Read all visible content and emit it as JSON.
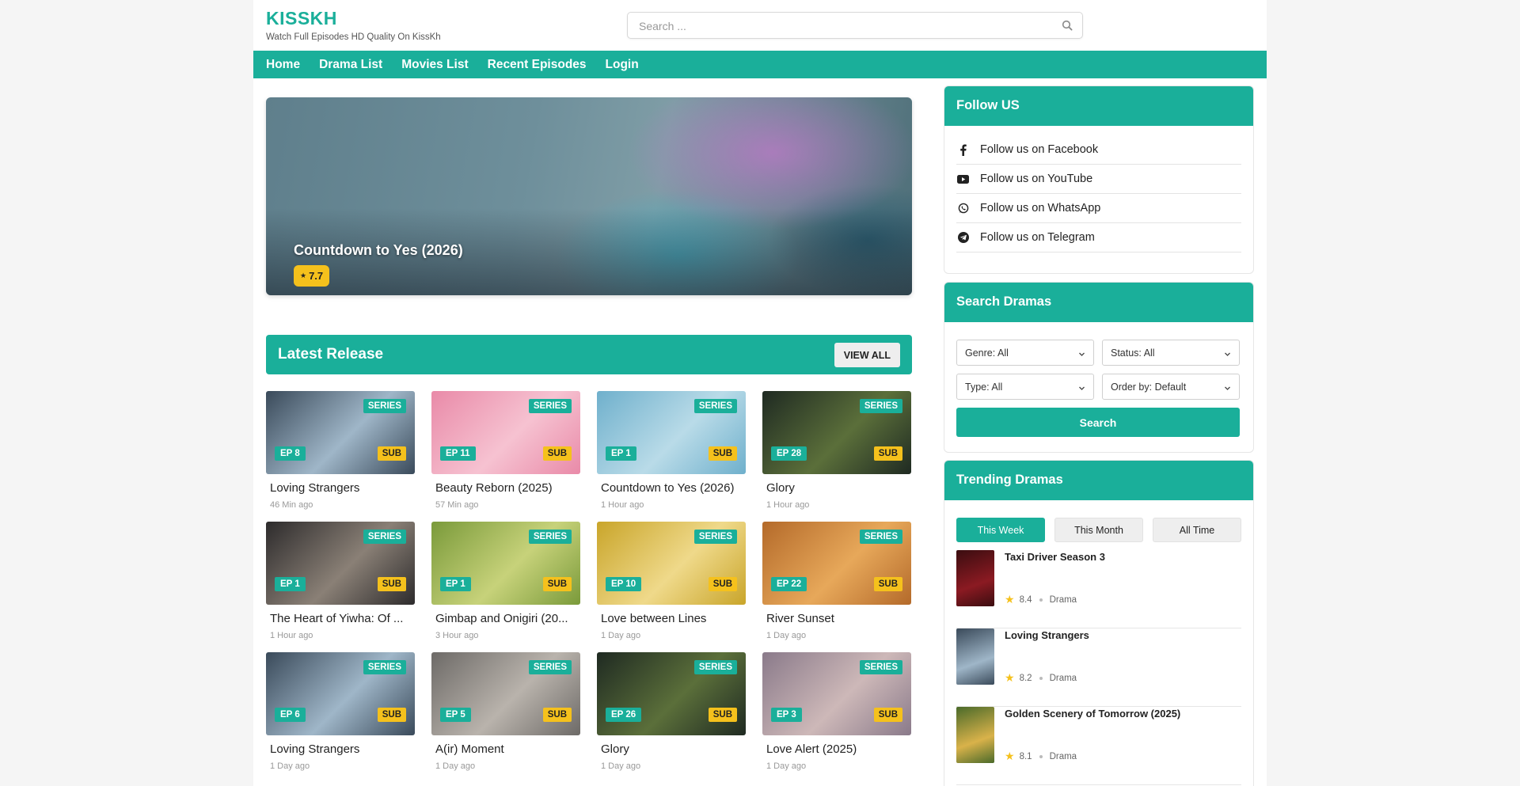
{
  "site": {
    "logo": "KISSKH",
    "tagline": "Watch Full Episodes HD Quality On KissKh",
    "search_placeholder": "Search ..."
  },
  "nav": {
    "items": [
      "Home",
      "Drama List",
      "Movies List",
      "Recent Episodes",
      "Login"
    ]
  },
  "hero": {
    "title": "Countdown to Yes (2026)",
    "rating": "7.7",
    "rating_icon": "star-icon"
  },
  "latest": {
    "title": "Latest Release",
    "view_all": "VIEW ALL",
    "series_label": "SERIES",
    "sub_label": "SUB",
    "items": [
      {
        "title": "Loving Strangers",
        "ep": "EP 8",
        "time": "46 Min ago",
        "colors": [
          "#3a4a5a",
          "#9fb6c8"
        ]
      },
      {
        "title": "Beauty Reborn (2025)",
        "ep": "EP 11",
        "time": "57 Min ago",
        "colors": [
          "#e98aa8",
          "#f6c2d1"
        ]
      },
      {
        "title": "Countdown to Yes (2026)",
        "ep": "EP 1",
        "time": "1 Hour ago",
        "colors": [
          "#6fb0cc",
          "#b9dbe8"
        ]
      },
      {
        "title": "Glory",
        "ep": "EP 28",
        "time": "1 Hour ago",
        "colors": [
          "#1f2a22",
          "#5b6f3a"
        ]
      },
      {
        "title": "The Heart of Yiwha: Of ...",
        "ep": "EP 1",
        "time": "1 Hour ago",
        "colors": [
          "#2d2b2c",
          "#8a8076"
        ]
      },
      {
        "title": "Gimbap and Onigiri (20...",
        "ep": "EP 1",
        "time": "3 Hour ago",
        "colors": [
          "#7a9a3a",
          "#c7d27a"
        ]
      },
      {
        "title": "Love between Lines",
        "ep": "EP 10",
        "time": "1 Day ago",
        "colors": [
          "#c9a52a",
          "#efd98a"
        ]
      },
      {
        "title": "River Sunset",
        "ep": "EP 22",
        "time": "1 Day ago",
        "colors": [
          "#b46a2a",
          "#e7a85a"
        ]
      },
      {
        "title": "Loving Strangers",
        "ep": "EP 6",
        "time": "1 Day ago",
        "colors": [
          "#3a4a5a",
          "#9fb6c8"
        ]
      },
      {
        "title": "A(ir) Moment",
        "ep": "EP 5",
        "time": "1 Day ago",
        "colors": [
          "#6d6a67",
          "#b9b3ac"
        ]
      },
      {
        "title": "Glory",
        "ep": "EP 26",
        "time": "1 Day ago",
        "colors": [
          "#1f2a22",
          "#5b6f3a"
        ]
      },
      {
        "title": "Love Alert (2025)",
        "ep": "EP 3",
        "time": "1 Day ago",
        "colors": [
          "#8a7a8a",
          "#cdb8b8"
        ]
      }
    ]
  },
  "follow": {
    "title": "Follow US",
    "items": [
      {
        "label": "Follow us on Facebook",
        "icon": "facebook-icon"
      },
      {
        "label": "Follow us on YouTube",
        "icon": "youtube-icon"
      },
      {
        "label": "Follow us on WhatsApp",
        "icon": "whatsapp-icon"
      },
      {
        "label": "Follow us on Telegram",
        "icon": "telegram-icon"
      }
    ]
  },
  "search_dramas": {
    "title": "Search Dramas",
    "genre": "Genre: All",
    "status": "Status: All",
    "type": "Type: All",
    "order": "Order by: Default",
    "button": "Search"
  },
  "trending": {
    "title": "Trending Dramas",
    "tabs": [
      "This Week",
      "This Month",
      "All Time"
    ],
    "active_tab": "This Week",
    "items": [
      {
        "title": "Taxi Driver Season 3",
        "rating": "8.4",
        "category": "Drama",
        "colors": [
          "#3a0d10",
          "#8b1a22"
        ]
      },
      {
        "title": "Loving Strangers",
        "rating": "8.2",
        "category": "Drama",
        "colors": [
          "#3a4a5a",
          "#9fb6c8"
        ]
      },
      {
        "title": "Golden Scenery of Tomorrow (2025)",
        "rating": "8.1",
        "category": "Drama",
        "colors": [
          "#4a6a2a",
          "#d9b24a"
        ]
      }
    ]
  },
  "accent_color": "#1aaf9a",
  "badge_color": "#f5c11c"
}
